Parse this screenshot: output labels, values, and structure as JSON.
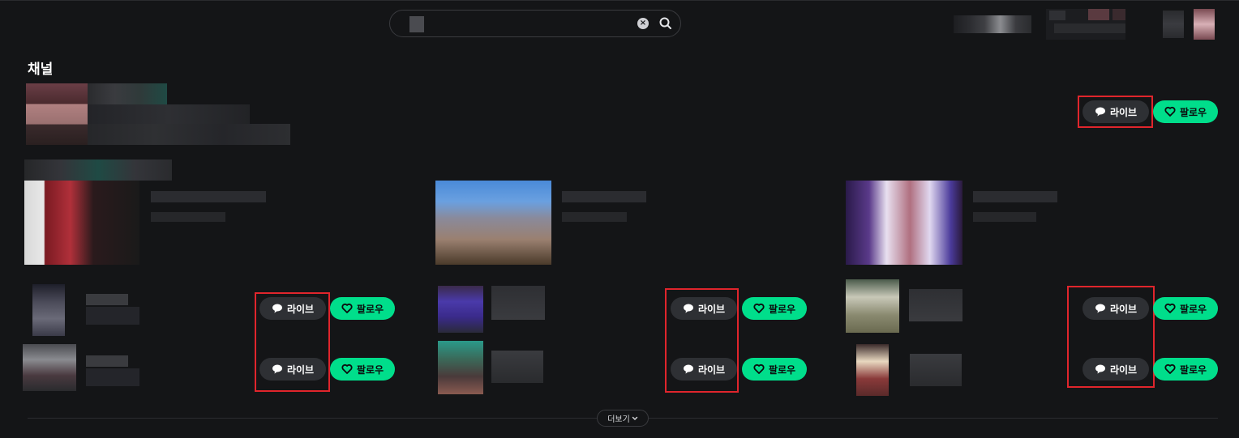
{
  "search": {
    "clear_icon": "clear-icon",
    "search_icon": "search-icon"
  },
  "section": {
    "title": "채널"
  },
  "buttons": {
    "live_label": "라이브",
    "follow_label": "팔로우"
  },
  "more": {
    "label": "더보기"
  },
  "colors": {
    "accent": "#00de8b",
    "live_bg": "#2e3034",
    "highlight": "#e0252c",
    "background": "#141517"
  }
}
